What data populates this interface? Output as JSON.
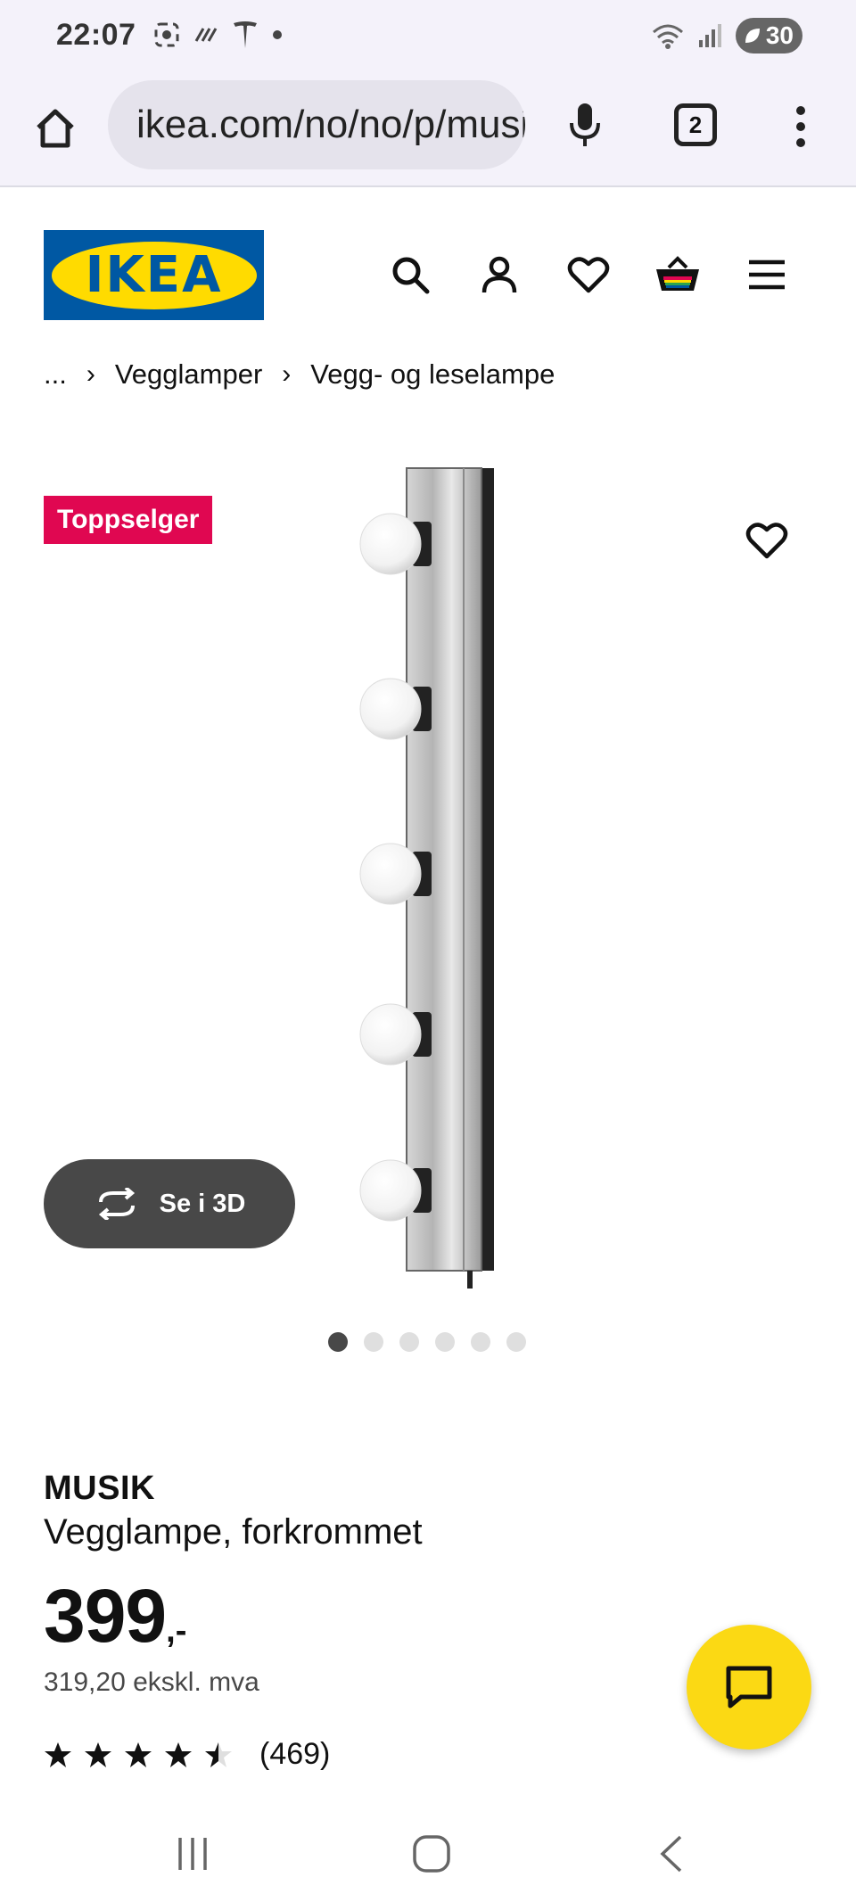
{
  "status_bar": {
    "time": "22:07",
    "battery_level": "30"
  },
  "browser": {
    "url": "ikea.com/no/no/p/musik-vegglampe",
    "tab_count": "2"
  },
  "breadcrumb": {
    "items": [
      "...",
      "Vegglamper",
      "Vegg- og leselampe"
    ]
  },
  "brand": {
    "logo_text": "IKEA",
    "blue": "#0058a3",
    "yellow": "#ffdb00"
  },
  "product": {
    "badge": "Toppselger",
    "view_3d_label": "Se i 3D",
    "name": "MUSIK",
    "description": "Vegglampe, forkrommet",
    "price_integer": "399",
    "price_suffix": ",-",
    "price_ex_vat": "319,20 ekskl. mva",
    "rating": 4.5,
    "rating_max": 5,
    "review_count": "(469)",
    "image_count": 6,
    "active_image_index": 0
  },
  "colors": {
    "badge_bg": "#e00751",
    "chat_button": "#fbd914",
    "dark_button": "#484848"
  },
  "icons": {
    "header": [
      "search-icon",
      "account-icon",
      "heart-icon",
      "cart-icon",
      "menu-icon"
    ],
    "nav": [
      "recent-apps-icon",
      "home-icon",
      "back-icon"
    ]
  }
}
